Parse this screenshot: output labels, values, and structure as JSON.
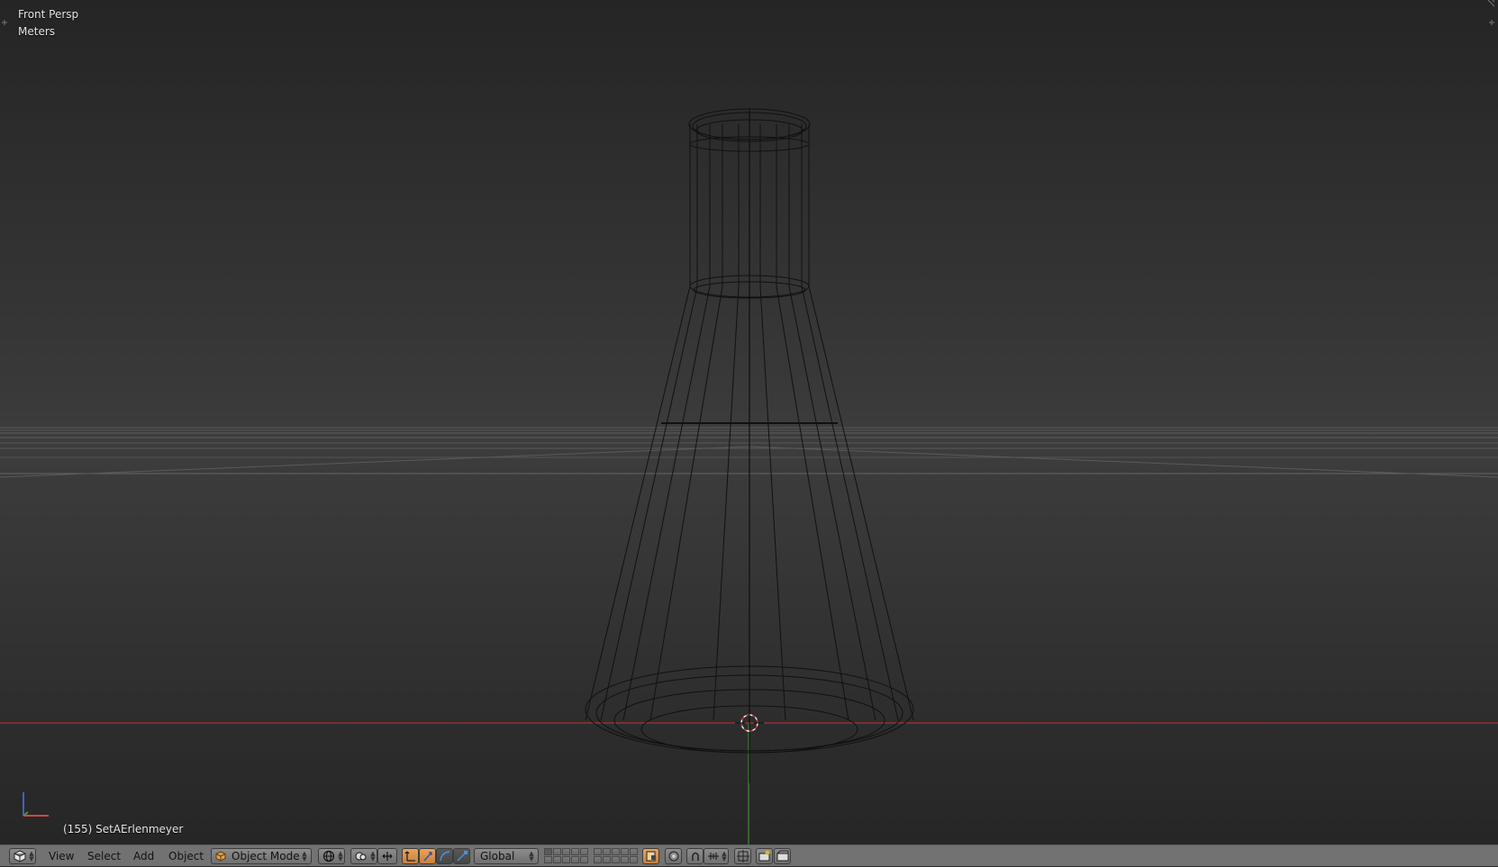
{
  "viewport": {
    "view_name": "Front Persp",
    "units": "Meters",
    "object_info": "(155) SetAErlenmeyer",
    "axis_gizmo": {
      "x_color": "#d24646",
      "y_color": "#5a8c3c",
      "z_color": "#4060c8"
    }
  },
  "header": {
    "editor_type_icon": "3d-view-icon",
    "menus": [
      "View",
      "Select",
      "Add",
      "Object"
    ],
    "mode": {
      "label": "Object Mode",
      "icon": "cube-icon"
    },
    "viewport_shading_icon": "wireframe-sphere-icon",
    "pivot_icon": "pivot-point-icon",
    "manipulator_icons": [
      "manipulator-toggle-icon",
      "translate-icon",
      "rotate-icon",
      "scale-icon"
    ],
    "transform_orientation": "Global",
    "lock_icon": "lock-layers-icon",
    "proportional_icon": "proportional-edit-icon",
    "snap_icons": [
      "snap-magnet-icon",
      "snap-element-icon"
    ],
    "render_icons": [
      "opengl-render-icon",
      "opengl-anim-icon"
    ]
  },
  "colors": {
    "x_axis_line": "#c83232",
    "y_axis_line": "#4aa03c",
    "active_toggle": "#e09a50",
    "header_bg": "#727272"
  }
}
